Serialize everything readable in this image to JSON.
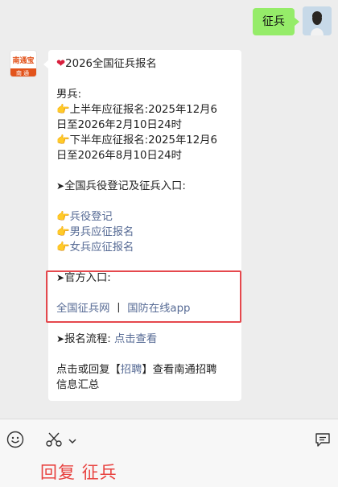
{
  "outgoing": {
    "text": "征兵"
  },
  "bot": {
    "avatar_top": "南通宝",
    "avatar_bottom": "南通"
  },
  "message": {
    "title": "2026全国征兵报名",
    "male_heading": "男兵:",
    "first_half": "上半年应征报名:2025年12月6",
    "first_half_2": "日至2026年2月10日24时",
    "second_half": "下半年应征报名:2025年12月6",
    "second_half_2": "日至2026年8月10日24时",
    "registry_heading": "全国兵役登记及征兵入口:",
    "links": [
      "兵役登记",
      "男兵应征报名",
      "女兵应征报名"
    ],
    "official_heading": "官方入口:",
    "official_link_1": "全国征兵网",
    "official_sep": "丨",
    "official_link_2": "国防在线app",
    "process_label": "报名流程:",
    "process_link": "点击查看",
    "footer_prefix": "点击或回复【",
    "footer_link": "招聘",
    "footer_suffix": "】查看南通招聘",
    "footer_line2": "信息汇总"
  },
  "toolbar": {
    "reply_hint": "回复 征兵"
  },
  "icons": {
    "heart": "heart-icon",
    "hand": "pointing-hand-icon",
    "arrow": "arrow-right-icon",
    "emoji": "emoji-icon",
    "scissors": "scissors-icon",
    "chevron": "chevron-down-icon",
    "chat": "chat-bubble-icon"
  },
  "colors": {
    "outgoing_bubble": "#95ec69",
    "link": "#576b95",
    "highlight_border": "#e5484d",
    "reply_hint": "#e8423f"
  }
}
